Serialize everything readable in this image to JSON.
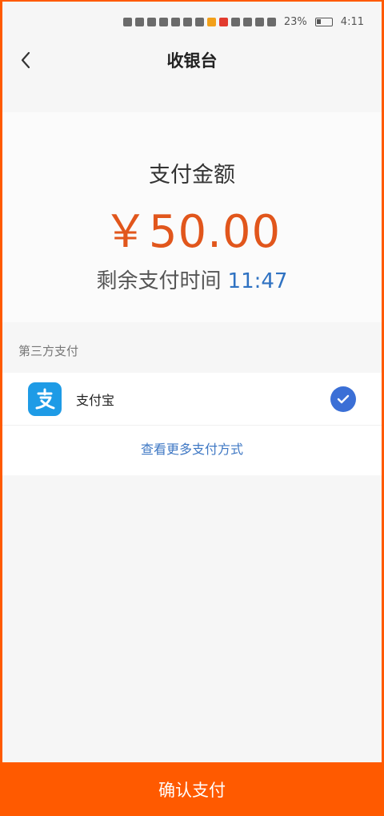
{
  "status_bar": {
    "battery": "23%",
    "time": "4:11"
  },
  "header": {
    "title": "收银台"
  },
  "payment": {
    "amount_label": "支付金额",
    "amount": "￥50.00",
    "remaining_label": "剩余支付时间",
    "remaining_time": "11:47"
  },
  "third_party": {
    "section_title": "第三方支付",
    "methods": [
      {
        "name": "支付宝",
        "icon": "alipay-icon",
        "selected": true
      }
    ],
    "more_link": "查看更多支付方式"
  },
  "confirm_button": {
    "label": "确认支付"
  },
  "colors": {
    "accent": "#ff5a00",
    "amount": "#e1561c",
    "link": "#3f78c4",
    "check": "#3b6fd6",
    "alipay": "#1e9be6"
  }
}
